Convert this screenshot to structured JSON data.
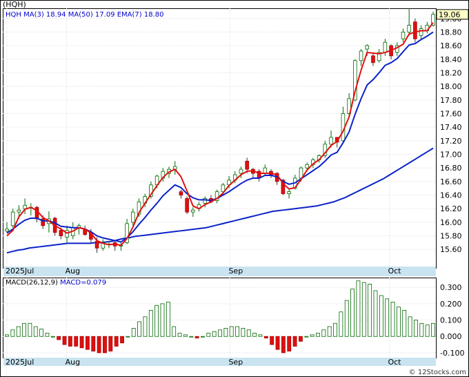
{
  "chart_data": [
    {
      "type": "candlestick",
      "ticker_label": "(HQH)",
      "legend": [
        {
          "text": "HQH",
          "color": "#0000cc"
        },
        {
          "text": "MA(3)",
          "color": "#0000cc"
        },
        {
          "text": "18.94",
          "color": "#0000cc"
        },
        {
          "text": "MA(50)",
          "color": "#0000cc"
        },
        {
          "text": "17.09",
          "color": "#0000cc"
        },
        {
          "text": "EMA(7)",
          "color": "#0000cc"
        },
        {
          "text": "18.80",
          "color": "#0000cc"
        }
      ],
      "last_price_label": "19.06",
      "x_labels": [
        {
          "text": "2025Jul",
          "index": 0
        },
        {
          "text": "Aug",
          "index": 15
        },
        {
          "text": "Sep",
          "index": 56
        },
        {
          "text": "Oct",
          "index": 96
        }
      ],
      "y_ticks": [
        "15.60",
        "15.80",
        "16.00",
        "16.20",
        "16.40",
        "16.60",
        "16.80",
        "17.00",
        "17.20",
        "17.40",
        "17.60",
        "17.80",
        "18.00",
        "18.20",
        "18.40",
        "18.60",
        "18.80",
        "19.00"
      ],
      "ylim": [
        15.45,
        19.15
      ],
      "up_color": "#ffffff",
      "down_color": "#e01010",
      "candles": [
        [
          15.87,
          16.0,
          15.85,
          15.9
        ],
        [
          15.95,
          16.2,
          15.92,
          16.15
        ],
        [
          16.15,
          16.25,
          16.05,
          16.18
        ],
        [
          16.2,
          16.35,
          16.12,
          16.25
        ],
        [
          16.22,
          16.28,
          16.1,
          16.22
        ],
        [
          16.22,
          16.24,
          16.0,
          16.05
        ],
        [
          16.05,
          16.1,
          15.9,
          15.95
        ],
        [
          15.98,
          16.16,
          15.85,
          16.05
        ],
        [
          16.06,
          16.08,
          15.8,
          15.85
        ],
        [
          15.88,
          15.92,
          15.75,
          15.8
        ],
        [
          15.78,
          15.95,
          15.7,
          15.88
        ],
        [
          15.8,
          16.0,
          15.75,
          15.92
        ],
        [
          15.92,
          15.98,
          15.82,
          15.95
        ],
        [
          15.9,
          15.95,
          15.8,
          15.82
        ],
        [
          15.85,
          15.9,
          15.7,
          15.75
        ],
        [
          15.72,
          15.78,
          15.55,
          15.62
        ],
        [
          15.62,
          15.75,
          15.58,
          15.7
        ],
        [
          15.68,
          15.72,
          15.62,
          15.68
        ],
        [
          15.7,
          15.74,
          15.58,
          15.65
        ],
        [
          15.65,
          15.7,
          15.58,
          15.66
        ],
        [
          15.7,
          16.05,
          15.68,
          15.98
        ],
        [
          16.0,
          16.2,
          15.95,
          16.15
        ],
        [
          16.12,
          16.35,
          16.08,
          16.3
        ],
        [
          16.28,
          16.42,
          16.22,
          16.38
        ],
        [
          16.38,
          16.6,
          16.35,
          16.55
        ],
        [
          16.55,
          16.7,
          16.5,
          16.68
        ],
        [
          16.65,
          16.8,
          16.6,
          16.75
        ],
        [
          16.72,
          16.82,
          16.65,
          16.78
        ],
        [
          16.78,
          16.9,
          16.7,
          16.82
        ],
        [
          16.45,
          16.48,
          16.35,
          16.4
        ],
        [
          16.35,
          16.38,
          16.12,
          16.15
        ],
        [
          16.15,
          16.22,
          16.08,
          16.18
        ],
        [
          16.2,
          16.3,
          16.16,
          16.26
        ],
        [
          16.28,
          16.38,
          16.22,
          16.35
        ],
        [
          16.35,
          16.4,
          16.28,
          16.3
        ],
        [
          16.32,
          16.48,
          16.28,
          16.45
        ],
        [
          16.45,
          16.58,
          16.4,
          16.55
        ],
        [
          16.55,
          16.68,
          16.5,
          16.62
        ],
        [
          16.62,
          16.75,
          16.58,
          16.7
        ],
        [
          16.72,
          16.82,
          16.65,
          16.78
        ],
        [
          16.9,
          16.95,
          16.72,
          16.78
        ],
        [
          16.78,
          16.8,
          16.65,
          16.72
        ],
        [
          16.75,
          16.78,
          16.6,
          16.65
        ],
        [
          16.72,
          16.85,
          16.68,
          16.8
        ],
        [
          16.75,
          16.78,
          16.65,
          16.7
        ],
        [
          16.72,
          16.74,
          16.55,
          16.6
        ],
        [
          16.62,
          16.64,
          16.4,
          16.42
        ],
        [
          16.42,
          16.48,
          16.35,
          16.45
        ],
        [
          16.5,
          16.7,
          16.48,
          16.65
        ],
        [
          16.65,
          16.82,
          16.6,
          16.8
        ],
        [
          16.8,
          16.88,
          16.75,
          16.85
        ],
        [
          16.85,
          16.95,
          16.8,
          16.92
        ],
        [
          16.92,
          17.0,
          16.88,
          16.98
        ],
        [
          16.98,
          17.2,
          16.95,
          17.15
        ],
        [
          17.15,
          17.35,
          17.1,
          17.25
        ],
        [
          17.25,
          17.2,
          17.1,
          17.18
        ],
        [
          17.2,
          17.7,
          17.18,
          17.6
        ],
        [
          17.6,
          17.9,
          17.55,
          17.82
        ],
        [
          17.8,
          18.4,
          17.78,
          18.38
        ],
        [
          18.38,
          18.55,
          18.3,
          18.52
        ],
        [
          18.55,
          18.62,
          18.45,
          18.6
        ],
        [
          18.45,
          18.5,
          18.3,
          18.35
        ],
        [
          18.38,
          18.55,
          18.35,
          18.5
        ],
        [
          18.5,
          18.7,
          18.45,
          18.65
        ],
        [
          18.6,
          18.62,
          18.4,
          18.45
        ],
        [
          18.5,
          18.65,
          18.45,
          18.6
        ],
        [
          18.7,
          18.85,
          18.65,
          18.8
        ],
        [
          18.8,
          19.15,
          18.75,
          18.9
        ],
        [
          18.95,
          19.0,
          18.65,
          18.7
        ],
        [
          18.75,
          18.9,
          18.7,
          18.85
        ],
        [
          18.82,
          18.95,
          18.78,
          18.9
        ],
        [
          18.9,
          19.1,
          18.88,
          19.06
        ]
      ],
      "ma50": [
        15.55,
        15.57,
        15.59,
        15.6,
        15.62,
        15.63,
        15.64,
        15.65,
        15.66,
        15.67,
        15.68,
        15.69,
        15.69,
        15.69,
        15.69,
        15.69,
        15.7,
        15.7,
        15.71,
        15.72,
        15.74,
        15.76,
        15.77,
        15.79,
        15.8,
        15.81,
        15.82,
        15.83,
        15.84,
        15.85,
        15.86,
        15.87,
        15.88,
        15.89,
        15.9,
        15.91,
        15.92,
        15.94,
        15.96,
        15.98,
        16.0,
        16.02,
        16.04,
        16.06,
        16.08,
        16.1,
        16.12,
        16.14,
        16.16,
        16.17,
        16.18,
        16.19,
        16.2,
        16.21,
        16.22,
        16.23,
        16.24,
        16.26,
        16.28,
        16.3,
        16.33,
        16.36,
        16.4,
        16.44,
        16.48,
        16.52,
        16.56,
        16.6,
        16.64,
        16.69,
        16.74,
        16.79,
        16.84,
        16.89,
        16.94,
        16.99,
        17.04,
        17.09
      ],
      "ema7": [
        15.84,
        15.9,
        15.97,
        16.03,
        16.06,
        16.06,
        16.02,
        16.02,
        15.99,
        15.94,
        15.93,
        15.92,
        15.92,
        15.9,
        15.86,
        15.8,
        15.77,
        15.75,
        15.73,
        15.71,
        15.77,
        15.86,
        15.97,
        16.07,
        16.18,
        16.28,
        16.39,
        16.47,
        16.55,
        16.51,
        16.42,
        16.36,
        16.33,
        16.33,
        16.32,
        16.35,
        16.4,
        16.45,
        16.51,
        16.57,
        16.62,
        16.65,
        16.65,
        16.69,
        16.69,
        16.67,
        16.6,
        16.56,
        16.58,
        16.64,
        16.7,
        16.76,
        16.82,
        16.9,
        16.99,
        17.03,
        17.17,
        17.33,
        17.59,
        17.82,
        18.02,
        18.1,
        18.2,
        18.31,
        18.35,
        18.41,
        18.51,
        18.61,
        18.63,
        18.69,
        18.74,
        18.8
      ],
      "ma3": [
        15.8,
        15.88,
        16.08,
        16.19,
        16.22,
        16.17,
        16.07,
        16.02,
        15.95,
        15.9,
        15.84,
        15.87,
        15.92,
        15.9,
        15.84,
        15.73,
        15.69,
        15.67,
        15.68,
        15.66,
        15.76,
        15.93,
        16.14,
        16.28,
        16.41,
        16.54,
        16.66,
        16.74,
        16.78,
        16.67,
        16.46,
        16.24,
        16.2,
        16.26,
        16.3,
        16.35,
        16.43,
        16.54,
        16.62,
        16.7,
        16.75,
        16.76,
        16.72,
        16.72,
        16.72,
        16.7,
        16.57,
        16.49,
        16.51,
        16.63,
        16.77,
        16.86,
        16.92,
        17.02,
        17.13,
        17.19,
        17.34,
        17.55,
        17.93,
        18.24,
        18.5,
        18.49,
        18.48,
        18.5,
        18.53,
        18.57,
        18.62,
        18.77,
        18.8,
        18.82,
        18.82,
        18.94
      ],
      "price_ma_cn": "MA(3)"
    },
    {
      "type": "bar",
      "legend": [
        {
          "text": "MACD(26,12,9)",
          "color": "#000000"
        },
        {
          "text": "MACD=0.079",
          "color": "#0000cc"
        }
      ],
      "x_labels": [
        {
          "text": "2025Jul",
          "index": 0
        },
        {
          "text": "Aug",
          "index": 15
        },
        {
          "text": "Sep",
          "index": 56
        },
        {
          "text": "Oct",
          "index": 96
        }
      ],
      "y_ticks": [
        "0.300",
        "0.200",
        "0.100",
        "0.000",
        "-0.100"
      ],
      "ylim": [
        -0.13,
        0.36
      ],
      "up_color": "#ffffff",
      "down_color": "#e01010",
      "values": [
        0.01,
        0.04,
        0.06,
        0.08,
        0.08,
        0.06,
        0.045,
        0.02,
        0.0,
        -0.02,
        -0.05,
        -0.06,
        -0.06,
        -0.07,
        -0.08,
        -0.09,
        -0.1,
        -0.1,
        -0.09,
        -0.06,
        -0.04,
        0.0,
        0.05,
        0.09,
        0.12,
        0.16,
        0.19,
        0.2,
        0.21,
        0.06,
        0.02,
        0.01,
        0.0,
        -0.01,
        0.0,
        0.02,
        0.03,
        0.04,
        0.05,
        0.06,
        0.06,
        0.05,
        0.04,
        0.02,
        0.01,
        -0.01,
        -0.05,
        -0.08,
        -0.1,
        -0.09,
        -0.06,
        -0.03,
        0.0,
        0.01,
        0.02,
        0.04,
        0.06,
        0.08,
        0.15,
        0.22,
        0.29,
        0.34,
        0.33,
        0.32,
        0.28,
        0.25,
        0.23,
        0.21,
        0.18,
        0.16,
        0.12,
        0.1,
        0.08,
        0.07,
        0.08
      ]
    }
  ],
  "footer": {
    "watermark": "© 12Stocks.com"
  }
}
